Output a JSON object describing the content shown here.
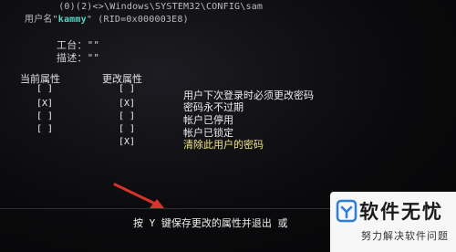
{
  "header": {
    "line1": "          (0)(2)<>\\Windows\\SYSTEM32\\CONFIG\\sam",
    "line2_prefix": "    ",
    "line2_user_label": "用户名\"",
    "line2_user_name": "kammy",
    "line2_rid": "\" (RID=0x000003E8)"
  },
  "fields": {
    "workgroup_label": "工台：\"\"",
    "description_label": "描述：\"\""
  },
  "columns": {
    "current": "当前属性",
    "change": "更改属性"
  },
  "rows": [
    {
      "current": "[ ]",
      "change": "[ ]",
      "desc": "用户下次登录时必须更改密码",
      "highlight": false
    },
    {
      "current": "[X]",
      "change": "[X]",
      "desc": "密码永不过期",
      "highlight": false
    },
    {
      "current": "[ ]",
      "change": "[ ]",
      "desc": "帐户已停用",
      "highlight": false
    },
    {
      "current": "[ ]",
      "change": "[ ]",
      "desc": "帐户已锁定",
      "highlight": false
    },
    {
      "current": "",
      "change": "[X]",
      "desc": "清除此用户的密码",
      "highlight": true
    }
  ],
  "footer": {
    "prompt": "按 Y 键保存更改的属性并退出 或"
  },
  "watermark": {
    "title": "软件无忧",
    "subtitle": "努力解决软件问题",
    "icon": "logo-icon"
  },
  "colors": {
    "highlight_user": "#57d6c8",
    "highlight_row": "#f1e488",
    "arrow": "#d9342b"
  }
}
